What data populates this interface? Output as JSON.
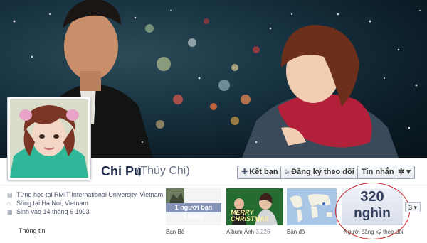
{
  "profile": {
    "name": "Chi Pu",
    "alternate_name": "(Thủy Chi)"
  },
  "actions": {
    "friend_label": "Kết bạn",
    "subscribe_label": "Đăng ký theo dõi",
    "message_label": "Tin nhắn",
    "settings_label": "✲ ▾"
  },
  "about": {
    "items": [
      {
        "icon": "graduation-cap-icon",
        "text": "Từng học tại RMIT International University, Vietnam"
      },
      {
        "icon": "home-icon",
        "text": "Sống tại Ha Noi, Vietnam"
      },
      {
        "icon": "cake-icon",
        "text": "Sinh vào 14 tháng 6 1993"
      }
    ],
    "link_label": "Thông tin"
  },
  "tiles": {
    "friends": {
      "label": "Bạn Bè",
      "badge": "1 người bạn chung"
    },
    "photos": {
      "label": "Album Ảnh",
      "count": "3.226",
      "banner_text": "MERRY CHRISTMAS"
    },
    "map": {
      "label": "Bản đồ"
    },
    "subscribers": {
      "count_line1": "320",
      "count_line2": "nghìn",
      "label": "Người đăng ký theo dõi"
    },
    "more": {
      "label": "3 ▾"
    }
  },
  "colors": {
    "name": "#1c2a47",
    "annotation_circle": "#c9262c",
    "badge": "#8594b6"
  }
}
